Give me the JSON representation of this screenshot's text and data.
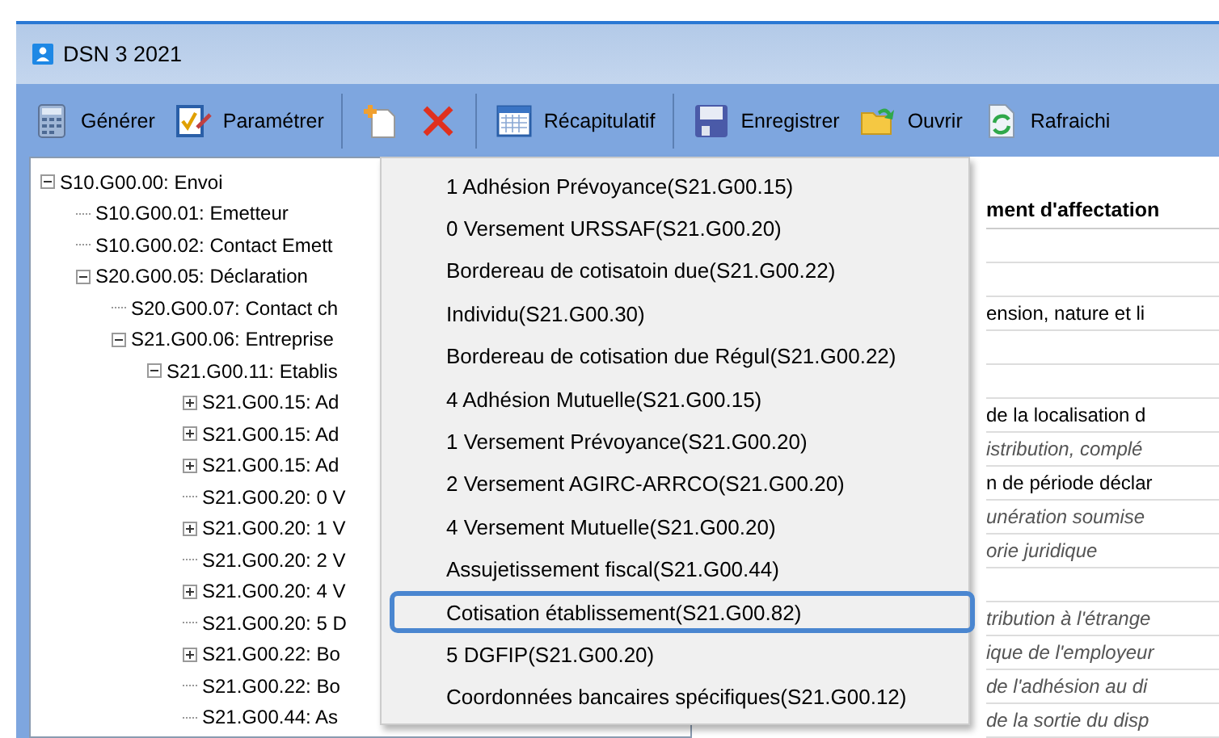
{
  "window": {
    "title": "DSN 3 2021"
  },
  "toolbar": [
    {
      "kind": "button",
      "label": "Générer"
    },
    {
      "kind": "button",
      "label": "Paramétrer"
    },
    {
      "kind": "separator"
    },
    {
      "kind": "button"
    },
    {
      "kind": "button"
    },
    {
      "kind": "separator"
    },
    {
      "kind": "button",
      "label": "Récapitulatif"
    },
    {
      "kind": "separator"
    },
    {
      "kind": "button",
      "label": "Enregistrer"
    },
    {
      "kind": "button",
      "label": "Ouvrir"
    },
    {
      "kind": "button",
      "label": "Rafraichi"
    }
  ],
  "tree": [
    {
      "label": "S10.G00.00: Envoi",
      "expanded": true,
      "children": [
        {
          "label": "S10.G00.01: Emetteur"
        },
        {
          "label": "S10.G00.02: Contact Emett"
        },
        {
          "label": "S20.G00.05: Déclaration",
          "expanded": true,
          "children": [
            {
              "label": "S20.G00.07: Contact ch"
            },
            {
              "label": "S21.G00.06: Entreprise",
              "expanded": true,
              "children": [
                {
                  "label": "S21.G00.11: Etablis",
                  "expanded": true,
                  "children": [
                    {
                      "label": "S21.G00.15: Ad",
                      "expanded": false
                    },
                    {
                      "label": "S21.G00.15: Ad",
                      "expanded": false
                    },
                    {
                      "label": "S21.G00.15: Ad",
                      "expanded": false
                    },
                    {
                      "label": "S21.G00.20: 0 V"
                    },
                    {
                      "label": "S21.G00.20: 1 V",
                      "expanded": false
                    },
                    {
                      "label": "S21.G00.20: 2 V"
                    },
                    {
                      "label": "S21.G00.20: 4 V",
                      "expanded": false
                    },
                    {
                      "label": "S21.G00.20: 5 D"
                    },
                    {
                      "label": "S21.G00.22: Bo",
                      "expanded": false
                    },
                    {
                      "label": "S21.G00.22: Bo"
                    },
                    {
                      "label": "S21.G00.44: As"
                    }
                  ]
                }
              ]
            }
          ]
        }
      ]
    }
  ],
  "detail_panel": {
    "header": "ment d'affectation",
    "rows": [
      {
        "kind": "empty"
      },
      {
        "kind": "empty"
      },
      {
        "kind": "value",
        "text": "ension, nature et li"
      },
      {
        "kind": "empty"
      },
      {
        "kind": "empty"
      },
      {
        "kind": "value",
        "text": "de la localisation d"
      },
      {
        "kind": "hint",
        "text": "istribution, complé"
      },
      {
        "kind": "value",
        "text": "n de période déclar"
      },
      {
        "kind": "hint",
        "text": "unération soumise"
      },
      {
        "kind": "hint",
        "text": "orie juridique"
      },
      {
        "kind": "empty"
      },
      {
        "kind": "hint",
        "text": "tribution à l'étrange"
      },
      {
        "kind": "hint",
        "text": "ique de l'employeur"
      },
      {
        "kind": "hint",
        "text": "de l'adhésion au di"
      },
      {
        "kind": "hint",
        "text": "de la sortie du disp"
      }
    ]
  },
  "context_menu": {
    "items": [
      {
        "label": "1 Adhésion Prévoyance(S21.G00.15)",
        "selected": false
      },
      {
        "label": "0 Versement URSSAF(S21.G00.20)",
        "selected": false
      },
      {
        "label": "Bordereau de cotisatoin due(S21.G00.22)",
        "selected": false
      },
      {
        "label": "Individu(S21.G00.30)",
        "selected": false
      },
      {
        "label": "Bordereau de cotisation due Régul(S21.G00.22)",
        "selected": false
      },
      {
        "label": "4 Adhésion Mutuelle(S21.G00.15)",
        "selected": false
      },
      {
        "label": "1 Versement Prévoyance(S21.G00.20)",
        "selected": false
      },
      {
        "label": "2 Versement AGIRC-ARRCO(S21.G00.20)",
        "selected": false
      },
      {
        "label": "4 Versement Mutuelle(S21.G00.20)",
        "selected": false
      },
      {
        "label": "Assujetissement fiscal(S21.G00.44)",
        "selected": false
      },
      {
        "label": "Cotisation établissement(S21.G00.82)",
        "selected": true
      },
      {
        "label": "5 DGFIP(S21.G00.20)",
        "selected": false
      },
      {
        "label": "Coordonnées bancaires spécifiques(S21.G00.12)",
        "selected": false
      }
    ]
  }
}
